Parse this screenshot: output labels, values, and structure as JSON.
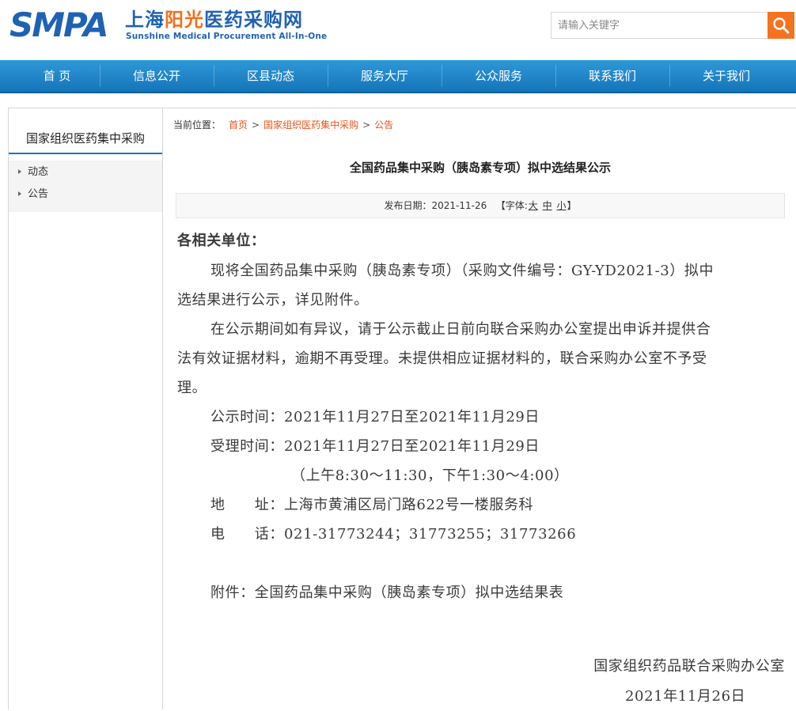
{
  "header": {
    "logo": {
      "brand": "SMPA",
      "cn_part1": "上海",
      "cn_part2": "阳光",
      "cn_part3": "医药",
      "cn_part4": "采购网",
      "en": "Sunshine Medical Procurement All-In-One"
    },
    "search": {
      "placeholder": "请输入关键字"
    }
  },
  "nav": {
    "items": [
      {
        "label": "首 页"
      },
      {
        "label": "信息公开"
      },
      {
        "label": "区县动态"
      },
      {
        "label": "服务大厅"
      },
      {
        "label": "公众服务"
      },
      {
        "label": "联系我们"
      },
      {
        "label": "关于我们"
      }
    ]
  },
  "sidebar": {
    "title": "国家组织医药集中采购",
    "items": [
      {
        "label": "动态"
      },
      {
        "label": "公告"
      }
    ]
  },
  "breadcrumb": {
    "label": "当前位置：",
    "items": [
      "首页",
      "国家组织医药集中采购",
      "公告"
    ],
    "separator": ">"
  },
  "article": {
    "title": "全国药品集中采购（胰岛素专项）拟中选结果公示",
    "meta": {
      "date_label": "发布日期：",
      "date": "2021-11-26",
      "font_prefix": "【字体:",
      "font_large": "大",
      "font_medium": "中",
      "font_small": "小",
      "font_suffix": "】"
    },
    "lines": [
      "各相关单位：",
      "现将全国药品集中采购（胰岛素专项）（采购文件编号：GY-YD2021-3）拟中",
      "选结果进行公示，详见附件。",
      "在公示期间如有异议，请于公示截止日前向联合采购办公室提出申诉并提供合",
      "法有效证据材料，逾期不再受理。未提供相应证据材料的，联合采购办公室不予受",
      "理。",
      "公示时间：2021年11月27日至2021年11月29日",
      "受理时间：2021年11月27日至2021年11月29日",
      "（上午8:30～11:30，下午1:30～4:00）",
      "地　　址：上海市黄浦区局门路622号一楼服务科",
      "电　　话：021-31773244；31773255；31773266",
      "附件：全国药品集中采购（胰岛素专项）拟中选结果表",
      "国家组织药品联合采购办公室",
      "2021年11月26日"
    ]
  },
  "colors": {
    "nav_top": "#2f98d9",
    "nav_bottom": "#1475b9",
    "brand_blue": "#1f62b5",
    "brand_orange": "#f0701c",
    "link_orange": "#e8541b",
    "search_button": "#f37320"
  },
  "icons": {
    "search_button": "search-icon",
    "sidebar_bullet": "caret-right-icon"
  }
}
